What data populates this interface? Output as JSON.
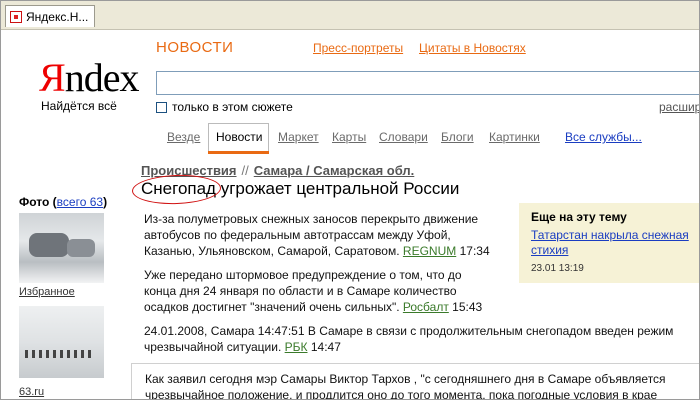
{
  "tab": {
    "title": "Яндекс.Н..."
  },
  "logo": {
    "first_letter": "Я",
    "rest": "ndex",
    "tagline": "Найдётся всё"
  },
  "header": {
    "section": "НОВОСТИ",
    "links": [
      "Пресс-портреты",
      "Цитаты в Новостях"
    ]
  },
  "search": {
    "value": "",
    "checkbox_label": "только в этом сюжете",
    "advanced": "расшир"
  },
  "nav": {
    "items": [
      "Везде",
      "Новости",
      "Маркет",
      "Карты",
      "Словари",
      "Блоги",
      "Картинки"
    ],
    "active": "Новости",
    "services": "Все службы..."
  },
  "breadcrumb": {
    "category": "Происшествия",
    "separator": "//",
    "region": "Самара / Самарская обл."
  },
  "headline": {
    "highlight": "Снегопад",
    "rest": " угрожает центральной России"
  },
  "photos": {
    "label": "Фото",
    "all_link": "всего 63",
    "items": [
      {
        "caption": "Избранное"
      },
      {
        "caption": "63.ru"
      }
    ]
  },
  "stories": [
    {
      "line1": "Из-за полуметровых снежных заносов перекрыто движение",
      "line2": "автобусов по федеральным автотрассам между Уфой,",
      "line3": "Казанью, Ульяновском, Самарой, Саратовом.",
      "source": "REGNUM",
      "time": "17:34"
    },
    {
      "line1": "Уже передано штормовое предупреждение о том, что до",
      "line2": "конца дня 24 января по области и в Самаре количество",
      "line3": "осадков достигнет \"значений очень сильных\".",
      "source": "Росбалт",
      "time": "15:43"
    },
    {
      "line1": "24.01.2008, Самара 14:47:51 В Самаре в связи с продолжительным снегопадом введен режим",
      "line2": "чрезвычайной ситуации.",
      "source": "РБК",
      "time": "14:47"
    }
  ],
  "sidebar": {
    "title": "Еще на эту тему",
    "link": "Татарстан накрыла снежная стихия",
    "time": "23.01 13:19"
  },
  "quote": {
    "line1": "Как заявил сегодня мэр Самары Виктор Тархов , \"с сегодняшнего дня в Самаре объявляется",
    "line2": "чрезвычайное положение, и продлится оно до того момента, пока погодные условия в крае"
  }
}
